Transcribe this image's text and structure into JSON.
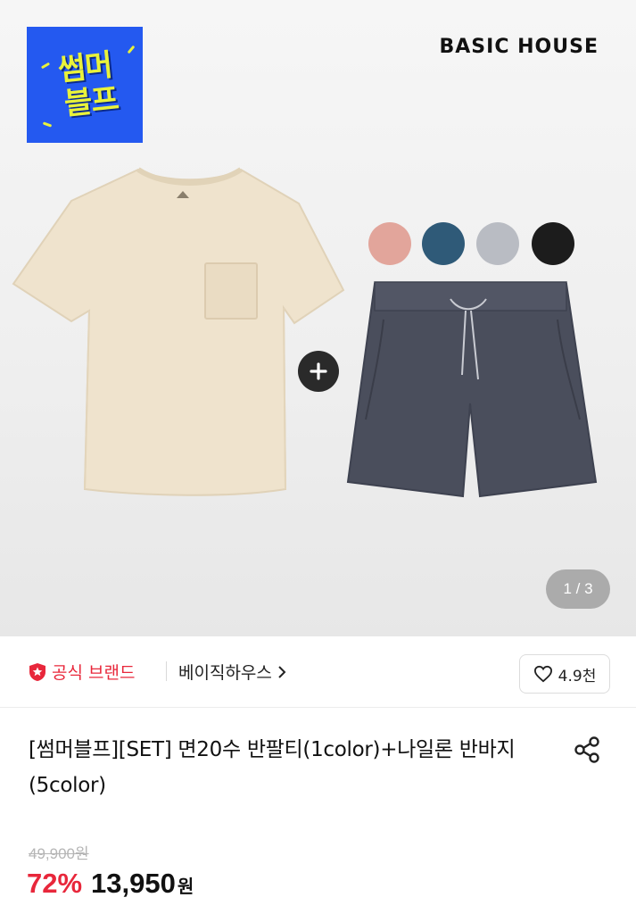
{
  "hero": {
    "promo_badge": {
      "line1": "썸머",
      "line2": "블프",
      "bg_color": "#2459f0",
      "text_color": "#e9f23a"
    },
    "brand_logo": "BASIC HOUSE",
    "color_swatches": [
      "#e2a59b",
      "#2f5a78",
      "#b9bcc3",
      "#1c1c1c"
    ],
    "pager": "1 / 3",
    "plus_icon": "plus-icon"
  },
  "brand_row": {
    "official_label": "공식 브랜드",
    "brand_name": "베이직하우스",
    "likes": "4.9천",
    "accent_color": "#e8273b"
  },
  "product": {
    "title": "[썸머블프][SET] 면20수 반팔티(1color)+나일론 반바지(5color)",
    "original_price": "49,900원",
    "discount": "72%",
    "sale_price": "13,950",
    "currency": "원"
  }
}
